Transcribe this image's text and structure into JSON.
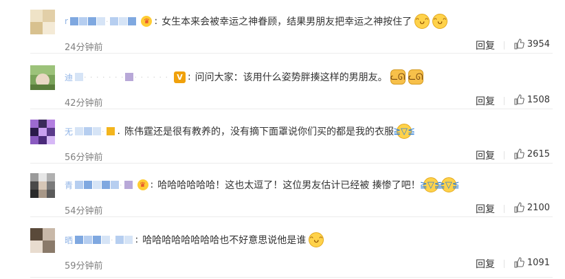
{
  "colors": {
    "text": "#333333",
    "muted": "#808080",
    "divider": "#ececec",
    "username_blur": "#7fa8e0"
  },
  "comments": [
    {
      "user": {
        "visible_char": "r",
        "badge": "crown"
      },
      "text": "女生本来会被幸运之神眷顾，结果男朋友把幸运之神按住了",
      "emojis": [
        "laugh",
        "laugh"
      ],
      "time": "24分钟前",
      "reply_label": "回复",
      "likes": "3954"
    },
    {
      "user": {
        "visible_char": "迪",
        "badge": "v"
      },
      "text": "问问大家：该用什么姿势胖揍这样的男朋友。",
      "emojis": [
        "cat",
        "cat"
      ],
      "time": "42分钟前",
      "reply_label": "回复",
      "likes": "1508"
    },
    {
      "user": {
        "visible_char": "无",
        "badge": "yellow"
      },
      "text": "陈伟霆还是很有教养的，没有摘下面罩说你们买的都是我的衣服",
      "emojis": [
        "cry"
      ],
      "time": "56分钟前",
      "reply_label": "回复",
      "likes": "2615"
    },
    {
      "user": {
        "visible_char": "青",
        "badge": "crown"
      },
      "text": "哈哈哈哈哈哈！这也太逗了！这位男友估计已经被 揍惨了吧！",
      "emojis": [
        "cry",
        "cry"
      ],
      "time": "54分钟前",
      "reply_label": "回复",
      "likes": "2100"
    },
    {
      "user": {
        "visible_char": "晒",
        "badge": "none"
      },
      "text": "哈哈哈哈哈哈哈哈也不好意思说他是谁",
      "emojis": [
        "laugh"
      ],
      "time": "59分钟前",
      "reply_label": "回复",
      "likes": "1091"
    }
  ]
}
